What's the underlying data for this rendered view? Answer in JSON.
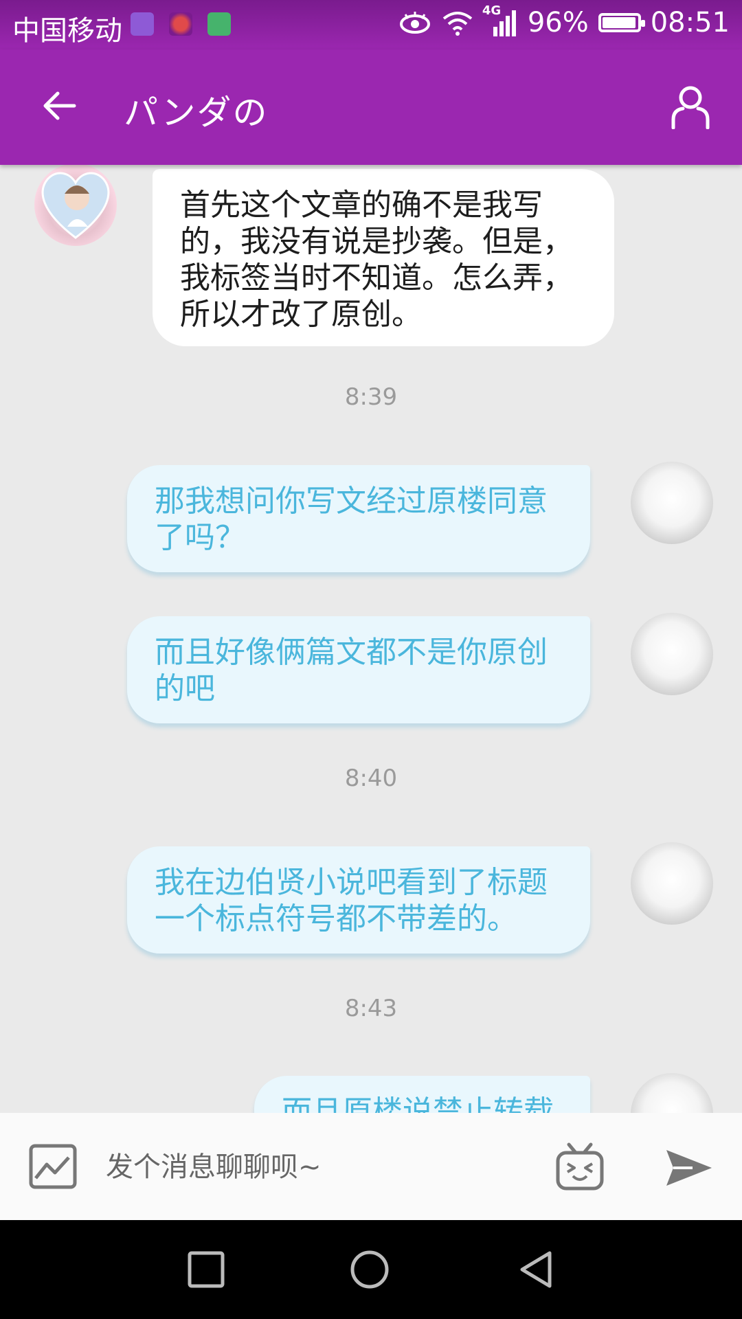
{
  "status_bar": {
    "carrier": "中国移动",
    "network": "4G",
    "battery": "96%",
    "battery_level": 0.96,
    "time": "08:51"
  },
  "header": {
    "title": "パンダの",
    "back_icon": "arrow-left-icon",
    "profile_icon": "person-icon"
  },
  "messages": [
    {
      "side": "in",
      "text": "首先这个文章的确不是我写的，我没有说是抄袭。但是，我标签当时不知道。怎么弄，所以才改了原创。"
    },
    {
      "timestamp": "8:39"
    },
    {
      "side": "out",
      "text": "那我想问你写文经过原楼同意了吗？"
    },
    {
      "side": "out",
      "text": "而且好像俩篇文都不是你原创的吧"
    },
    {
      "timestamp": "8:40"
    },
    {
      "side": "out",
      "text": "我在边伯贤小说吧看到了标题一个标点符号都不带差的。"
    },
    {
      "timestamp": "8:43"
    },
    {
      "side": "out",
      "text": "而且原楼说禁止转载"
    }
  ],
  "input": {
    "placeholder": "发个消息聊聊呗~",
    "image_icon": "image-icon",
    "emoji_icon": "emoji-tv-icon",
    "send_icon": "send-icon"
  },
  "colors": {
    "primary": "#9b27b0",
    "outgoing_bubble": "#e9f7fd",
    "outgoing_text": "#4ab6dc",
    "incoming_bubble": "#ffffff",
    "chat_background": "#eaeaea"
  }
}
